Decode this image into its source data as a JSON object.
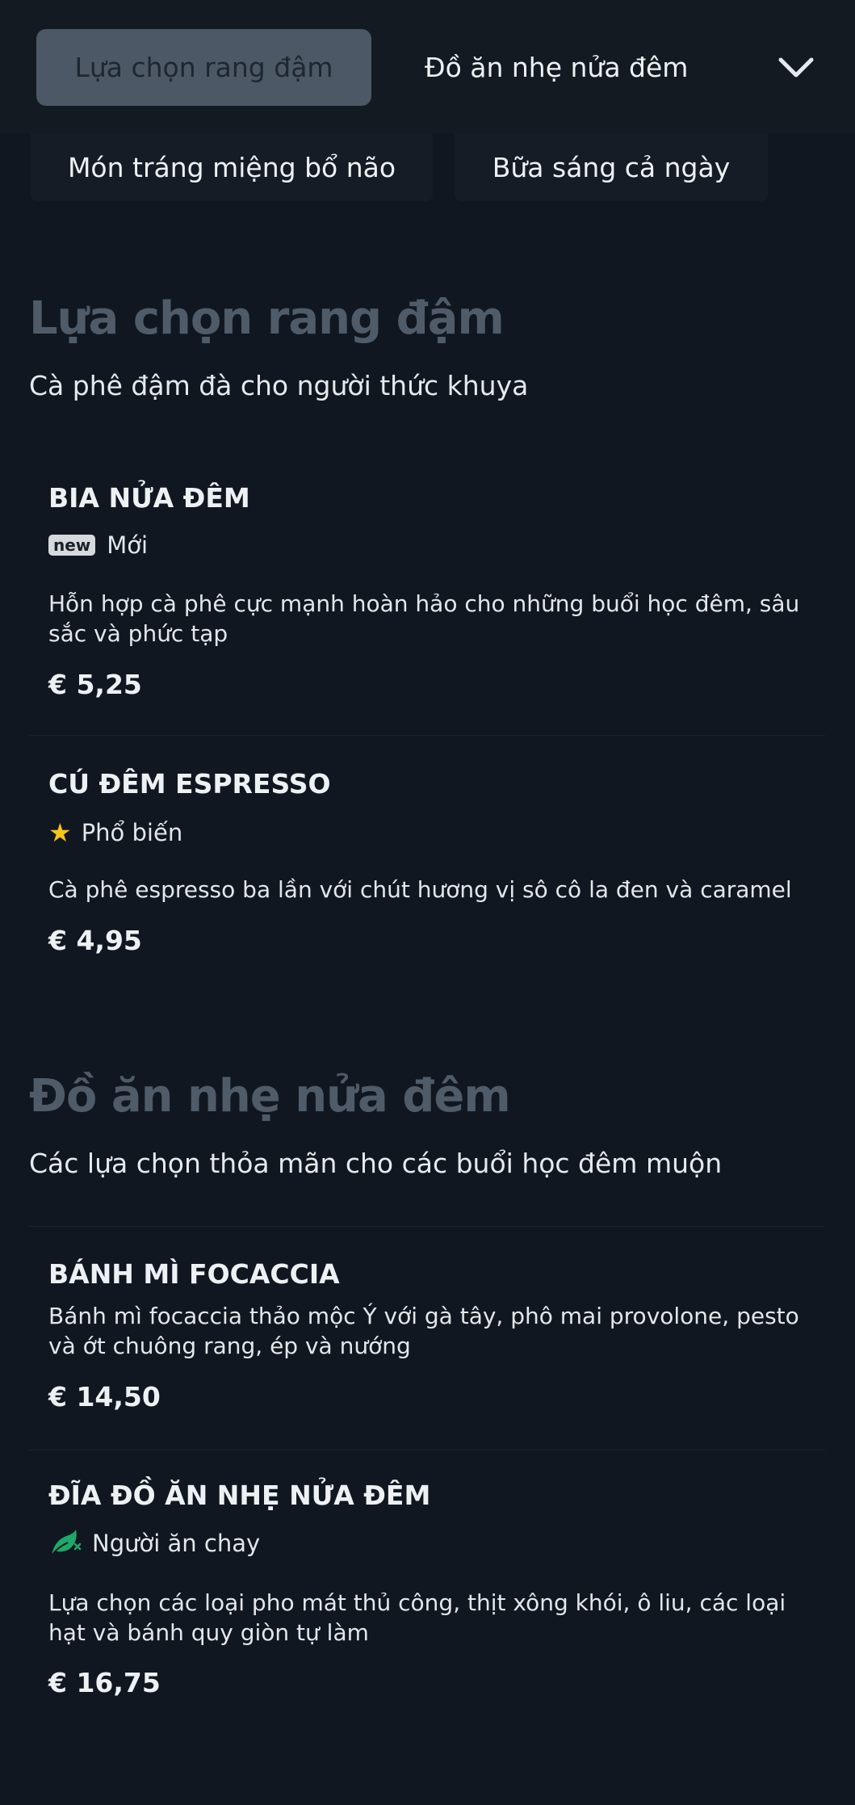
{
  "tabs": [
    {
      "label": "Lựa chọn rang đậm",
      "active": true
    },
    {
      "label": "Đồ ăn nhẹ nửa đêm",
      "active": false
    },
    {
      "label": "Món tráng miệng bổ não",
      "active": false
    },
    {
      "label": "Bữa sáng cả ngày",
      "active": false
    }
  ],
  "expand_icon": "chevron-down-icon",
  "sections": [
    {
      "title": "Lựa chọn rang đậm",
      "subtitle": "Cà phê đậm đà cho người thức khuya",
      "items": [
        {
          "name": "BIA NỬA ĐÊM",
          "badge": "new",
          "tag": "Mới",
          "description": "Hỗn hợp cà phê cực mạnh hoàn hảo cho những buổi học đêm, sâu sắc và phức tạp",
          "price": "€ 5,25"
        },
        {
          "name": "CÚ ĐÊM ESPRESSO",
          "tag_icon": "star-icon",
          "tag": "Phổ biến",
          "description": "Cà phê espresso ba lần với chút hương vị sô cô la đen và caramel",
          "price": "€ 4,95"
        }
      ]
    },
    {
      "title": "Đồ ăn nhẹ nửa đêm",
      "subtitle": "Các lựa chọn thỏa mãn cho các buổi học đêm muộn",
      "items": [
        {
          "name": "BÁNH MÌ FOCACCIA",
          "description": "Bánh mì focaccia thảo mộc Ý với gà tây, phô mai provolone, pesto và ớt chuông rang, ép và nướng",
          "price": "€ 14,50"
        },
        {
          "name": "ĐĨA ĐỒ ĂN NHẸ NỬA ĐÊM",
          "tag_icon": "leaf-icon",
          "tag": "Người ăn chay",
          "description": "Lựa chọn các loại pho mát thủ công, thịt xông khói, ô liu, các loại hạt và bánh quy giòn tự làm",
          "price": "€ 16,75"
        }
      ]
    }
  ],
  "colors": {
    "background": "#111720",
    "active_tab": "#4c5866",
    "section_title": "#4f5b68",
    "star": "#f5c518",
    "vegetarian": "#1fa868"
  }
}
